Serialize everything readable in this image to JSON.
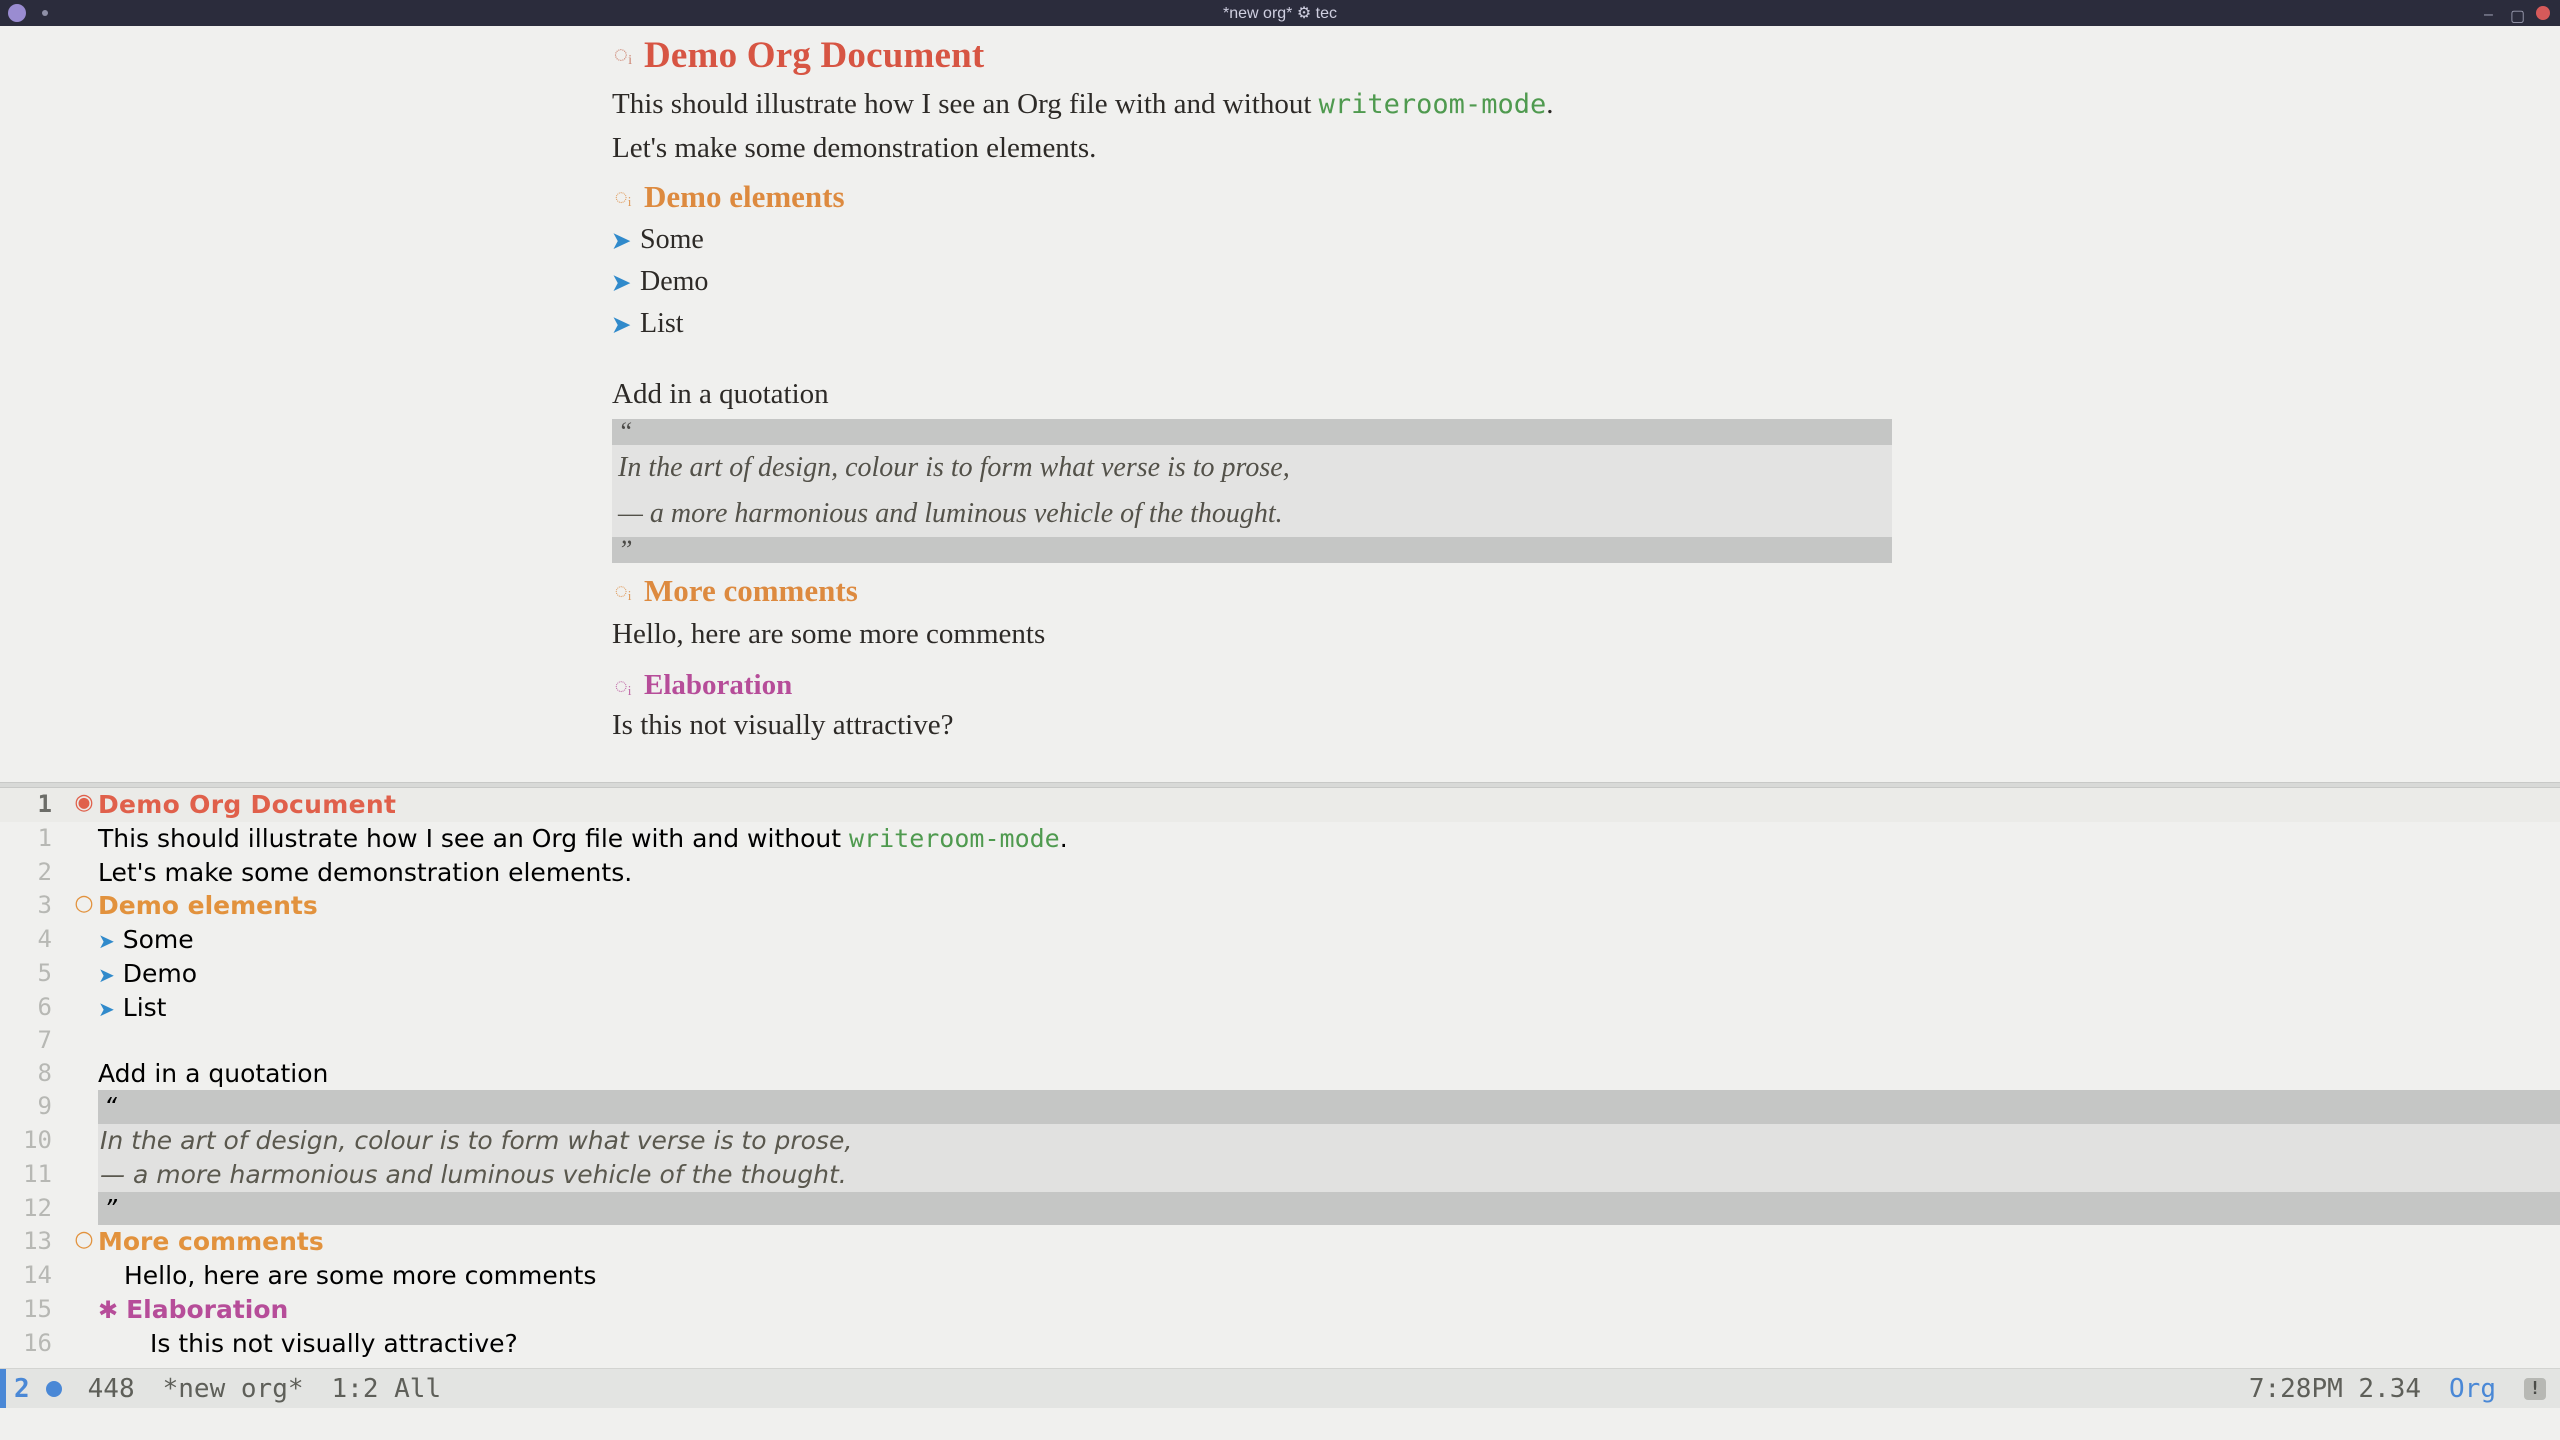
{
  "titlebar": {
    "buffer": "*new org*",
    "gear": "⚙",
    "user": "tec"
  },
  "doc": {
    "title": "Demo Org Document",
    "intro_a": "This should illustrate how I see an Org file with and without ",
    "intro_code": "writeroom-mode",
    "intro_b": ".",
    "intro2": "Let's make some demonstration elements.",
    "section1": "Demo elements",
    "list": [
      "Some",
      "Demo",
      "List"
    ],
    "quote_intro": "Add in a quotation",
    "quote_open": "“",
    "quote_l1": "In the art of design, colour is to form what verse is to prose,",
    "quote_l2": "— a more harmonious and luminous vehicle of the thought.",
    "quote_close": "”",
    "section2": "More comments",
    "section2_body": "Hello, here are some more comments",
    "section3": "Elaboration",
    "section3_body": "Is this not visually attractive?"
  },
  "src_lines": {
    "l1": "1",
    "l1b": "1",
    "l2": "2",
    "l3": "3",
    "l4": "4",
    "l5": "5",
    "l6": "6",
    "l7": "7",
    "l8": "8",
    "l9": "9",
    "l10": "10",
    "l11": "11",
    "l12": "12",
    "l13": "13",
    "l14": "14",
    "l15": "15",
    "l16": "16"
  },
  "markers": {
    "h1": "◉",
    "h2": "○",
    "h3": "✱",
    "head_glyph": "◌ᵢ"
  },
  "modeline": {
    "window": "2",
    "chars": "448",
    "buffer": "*new org*",
    "pos": "1:2",
    "scroll": "All",
    "time": "7:28PM",
    "load": "2.34",
    "mode": "Org",
    "warn": "!"
  }
}
